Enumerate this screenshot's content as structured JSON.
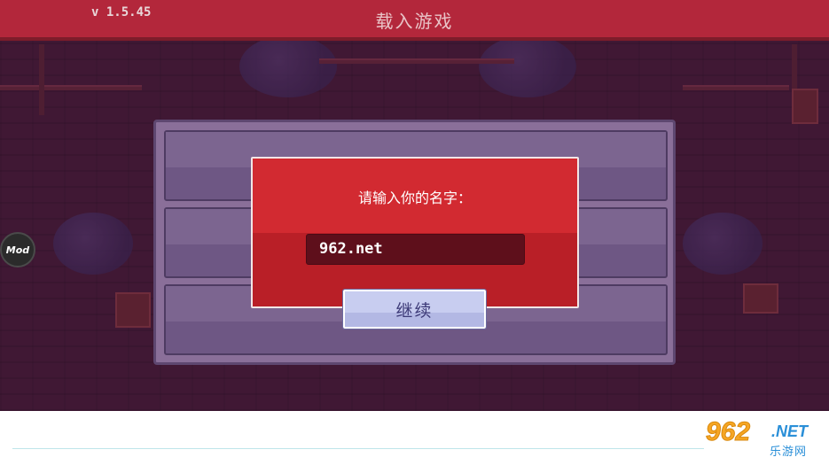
{
  "header": {
    "title": "载入游戏",
    "version": "v 1.5.45"
  },
  "side": {
    "mod_label": "Mod"
  },
  "save_slots": [
    {
      "id": "slot-1"
    },
    {
      "id": "slot-2"
    },
    {
      "id": "slot-3"
    }
  ],
  "dialog": {
    "prompt": "请输入你的名字：",
    "input_value": "962.net",
    "continue_label": "继续"
  },
  "watermark": {
    "number": "962",
    "domain": ".NET",
    "sub": "乐游网"
  },
  "colors": {
    "topbar": "#b3273b",
    "dialog": "#d22a31",
    "button": "#c8cdf0"
  }
}
